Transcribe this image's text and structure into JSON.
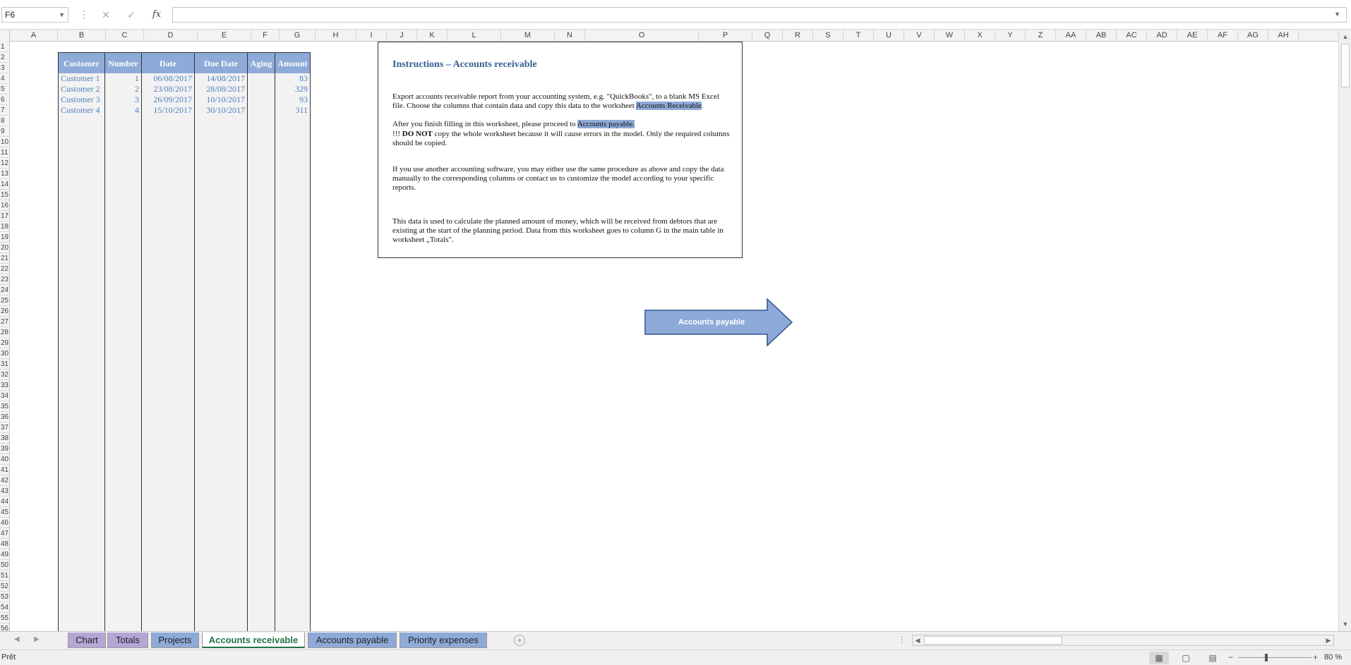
{
  "formula_bar": {
    "name_box": "F6",
    "formula": "",
    "fx": "fx",
    "cancel_glyph": "✕",
    "enter_glyph": "✓"
  },
  "columns": [
    "A",
    "B",
    "C",
    "D",
    "E",
    "F",
    "G",
    "H",
    "I",
    "J",
    "K",
    "L",
    "M",
    "N",
    "O",
    "P",
    "Q",
    "R",
    "S",
    "T",
    "U",
    "V",
    "W",
    "X",
    "Y",
    "Z",
    "AA",
    "AB",
    "AC",
    "AD",
    "AE",
    "AF",
    "AG",
    "AH"
  ],
  "rows": [
    "1",
    "2",
    "3",
    "4",
    "5",
    "6",
    "7",
    "8",
    "9",
    "10",
    "11",
    "12",
    "13",
    "14",
    "15",
    "16",
    "17",
    "18",
    "19",
    "20",
    "21",
    "22",
    "23",
    "24",
    "25",
    "26",
    "27",
    "28",
    "29",
    "30",
    "31",
    "32",
    "33",
    "34",
    "35",
    "36",
    "37",
    "38",
    "39",
    "40",
    "41",
    "42",
    "43",
    "44",
    "45",
    "46",
    "47",
    "48",
    "49",
    "50",
    "51",
    "52",
    "53",
    "54",
    "55",
    "56"
  ],
  "table": {
    "headers": [
      "Customer",
      "Number",
      "Date",
      "Due Date",
      "Aging",
      "Amount"
    ],
    "rows": [
      {
        "customer": "Customer 1",
        "number": "1",
        "date": "06/08/2017",
        "due_date": "14/08/2017",
        "aging": "",
        "amount": "83"
      },
      {
        "customer": "Customer 2",
        "number": "2",
        "date": "23/08/2017",
        "due_date": "28/08/2017",
        "aging": "",
        "amount": "329"
      },
      {
        "customer": "Customer 3",
        "number": "3",
        "date": "26/09/2017",
        "due_date": "10/10/2017",
        "aging": "",
        "amount": "93"
      },
      {
        "customer": "Customer 4",
        "number": "4",
        "date": "15/10/2017",
        "due_date": "30/10/2017",
        "aging": "",
        "amount": "311"
      }
    ]
  },
  "instructions": {
    "title": "Instructions – Accounts receivable",
    "p1": "Export accounts receivable report from your accounting system, e.g. \"QuickBooks\", to a blank MS Excel file. Choose the columns that contain data and copy this data to the worksheet",
    "p1_highlight": "Accounts Receivable",
    "p1_end": ".",
    "p2_start": "After you finish filling in this worksheet, please proceed to",
    "p2_highlight": "Accounts payable.",
    "p3_prefix": "!!!",
    "p3_bold": "DO NOT",
    "p3_rest": "copy the whole worksheet because it will cause errors in the model. Only the required columns should be copied.",
    "p4": "If you use another accounting software, you may either use the same procedure as above and copy the data manually to the corresponding columns or contact us to customize the model according to your specific reports.",
    "p5": "This data is used to calculate the planned amount of money, which will be received from debtors that are existing at the start of the planning period. Data from this worksheet goes to column G in the main table in worksheet „Totals\"."
  },
  "arrow_button": {
    "label": "Accounts payable",
    "fill": "#8eaad8",
    "stroke": "#2f528f"
  },
  "sheet_tabs": [
    {
      "label": "Chart",
      "color": "purple"
    },
    {
      "label": "Totals",
      "color": "purple"
    },
    {
      "label": "Projects",
      "color": "blue"
    },
    {
      "label": "Accounts receivable",
      "color": "active"
    },
    {
      "label": "Accounts payable",
      "color": "blue"
    },
    {
      "label": "Priority expenses",
      "color": "blue"
    }
  ],
  "add_sheet": "+",
  "status_bar": {
    "text": "Prêt",
    "zoom": "80 %"
  }
}
